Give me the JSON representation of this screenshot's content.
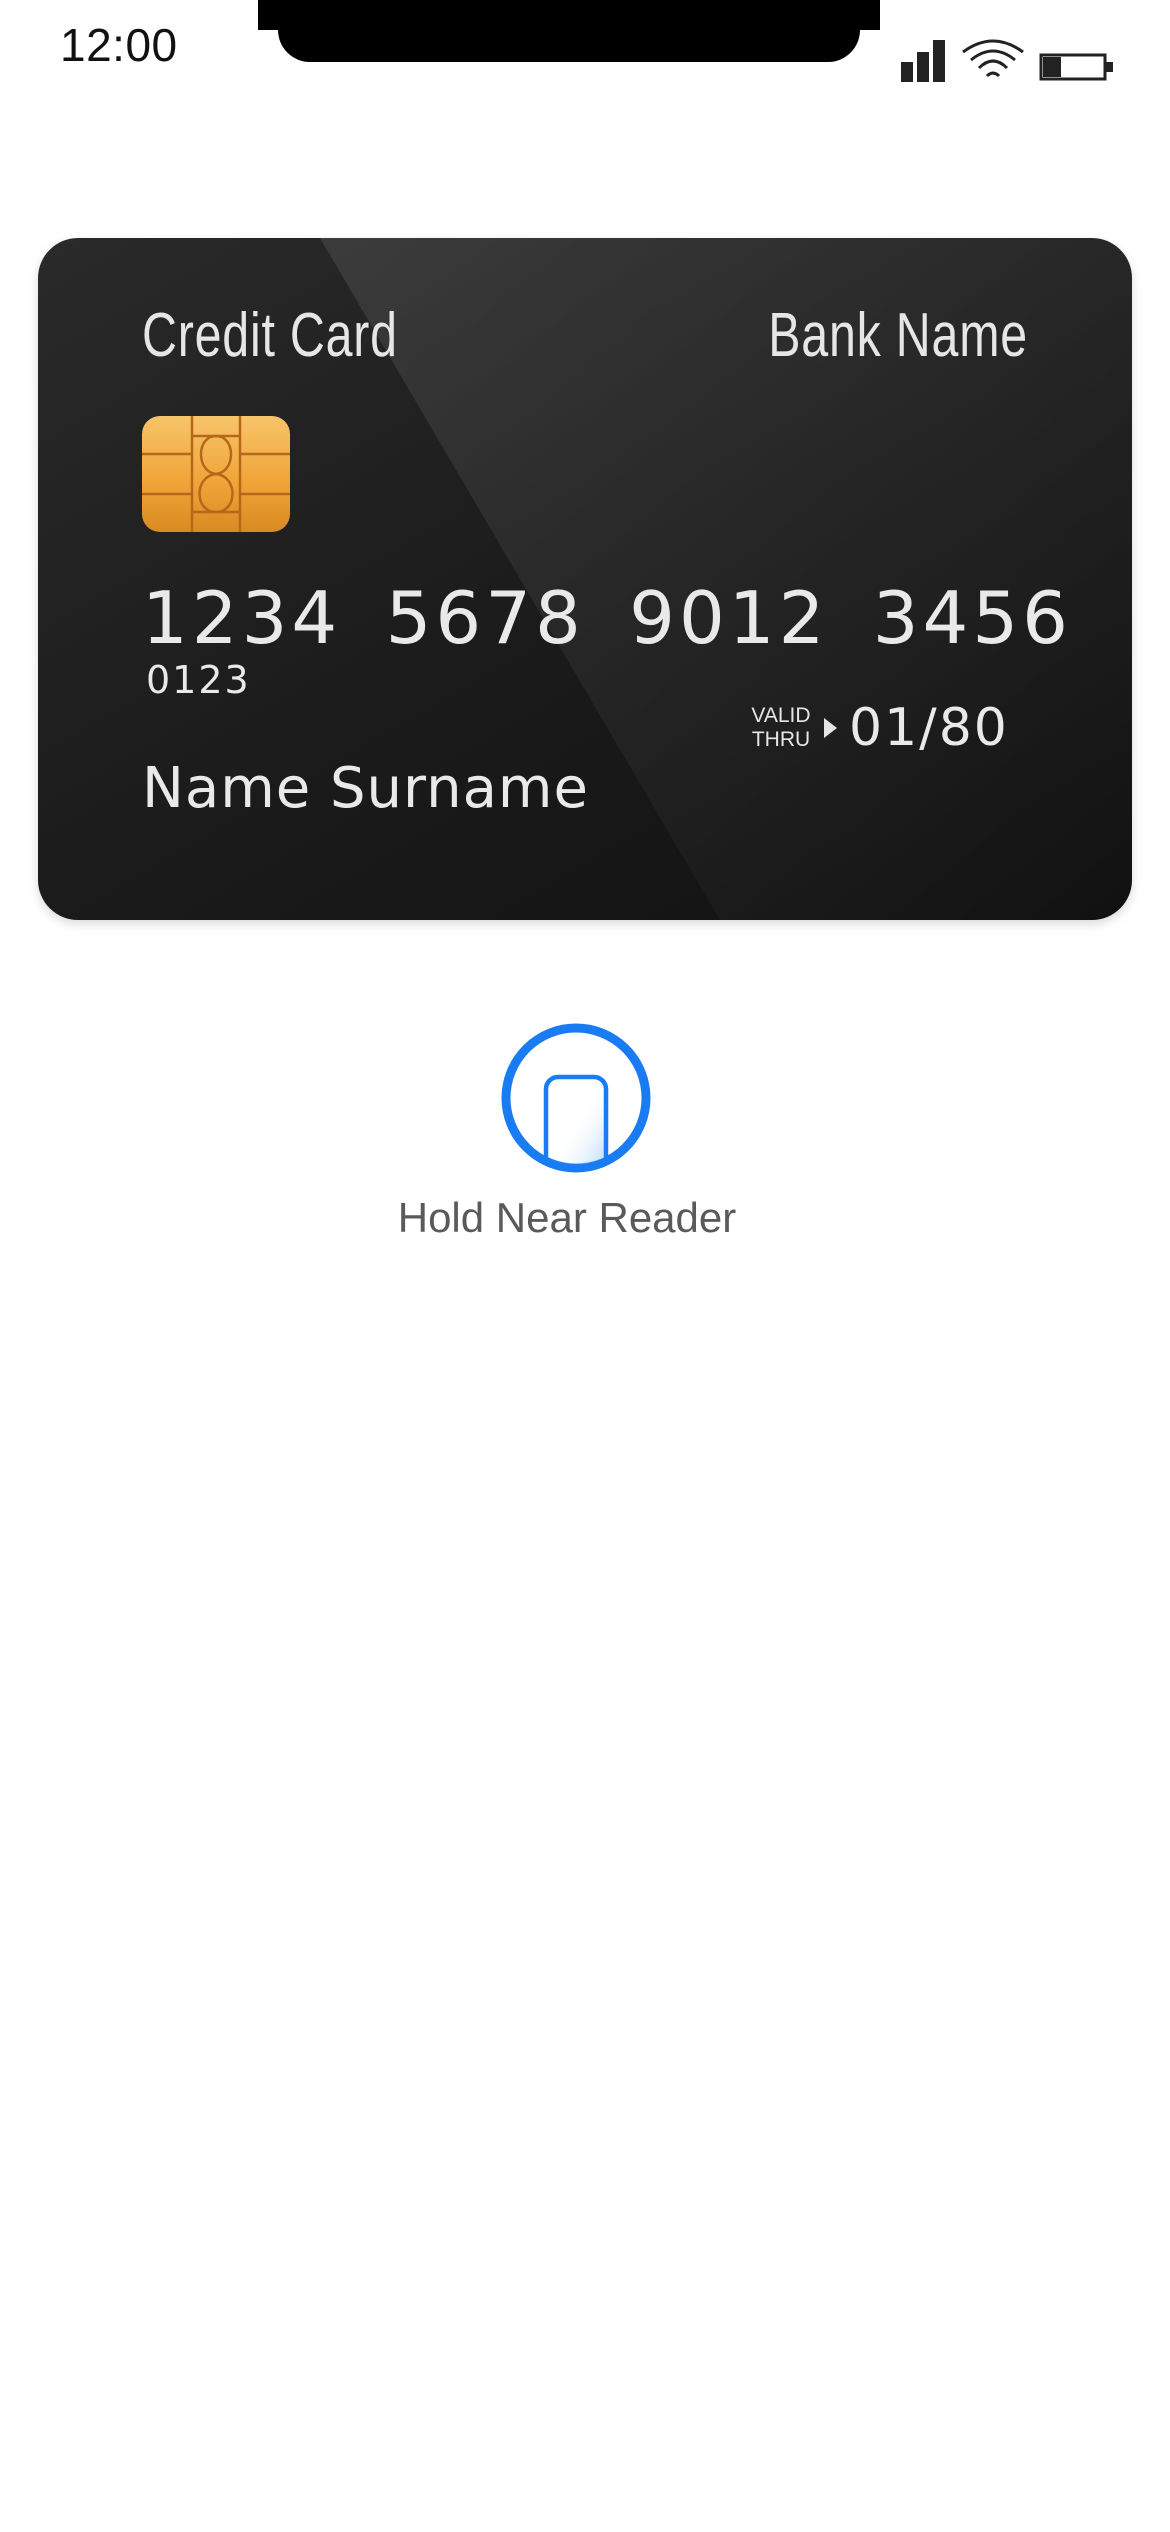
{
  "status_bar": {
    "time": "12:00",
    "icons": [
      "cellular-signal-icon",
      "wifi-icon",
      "battery-icon"
    ]
  },
  "card": {
    "title": "Credit Card",
    "bank_name": "Bank Name",
    "number_groups": [
      "1234",
      "5678",
      "9012",
      "3456"
    ],
    "sub_number": "0123",
    "valid_label_line1": "VALID",
    "valid_label_line2": "THRU",
    "valid_date": "01/80",
    "cardholder": "Name Surname",
    "chip_icon": "card-chip-icon"
  },
  "payment_prompt": {
    "icon": "phone-nfc-icon",
    "label": "Hold Near Reader",
    "accent_color": "#1a7cf2"
  }
}
